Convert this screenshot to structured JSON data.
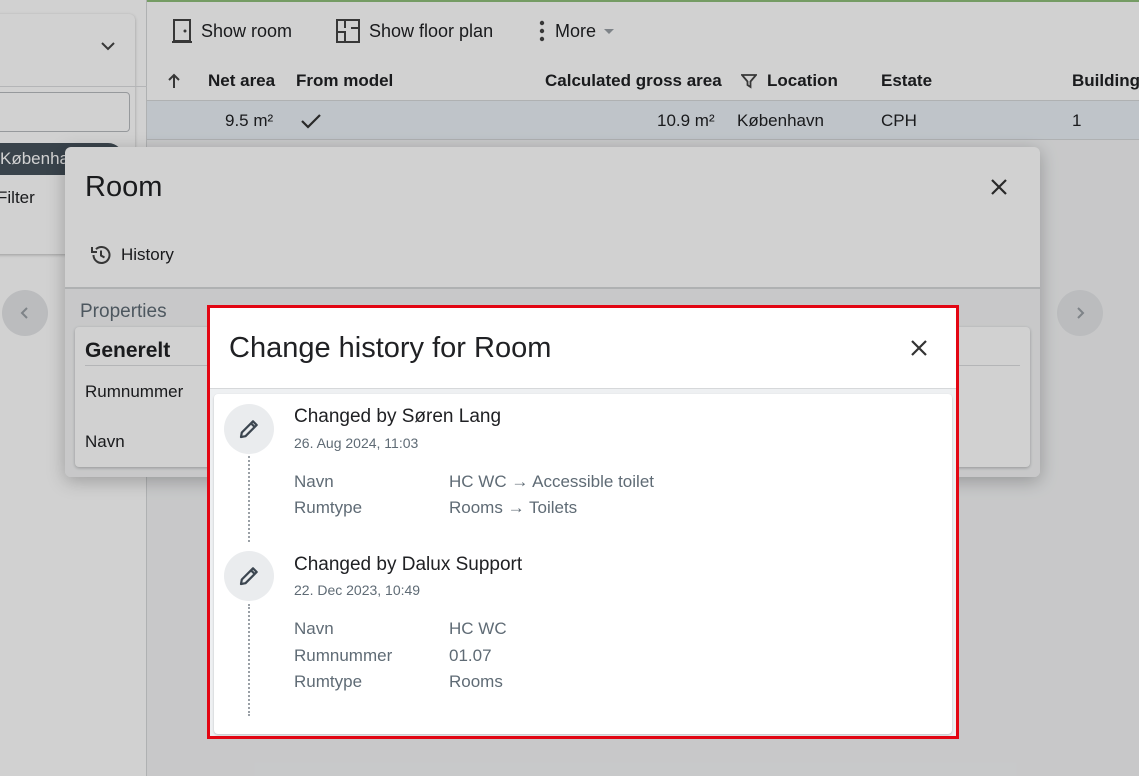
{
  "sidebar": {
    "chip_label": "København",
    "filter_label": "Filter"
  },
  "toolbar": {
    "show_room": "Show room",
    "show_floor_plan": "Show floor plan",
    "more": "More"
  },
  "table": {
    "columns": [
      "Net area",
      "From model",
      "Calculated gross area",
      "Location",
      "Estate",
      "Building"
    ],
    "row": {
      "net_area": "9.5 m²",
      "calculated_gross_area": "10.9 m²",
      "location": "København",
      "estate": "CPH",
      "building": "1"
    }
  },
  "room_dialog": {
    "title": "Room",
    "history_tab": "History",
    "properties_label": "Properties",
    "section_title": "Generelt",
    "fields": [
      "Rumnummer",
      "Navn"
    ]
  },
  "history_dialog": {
    "title": "Change history for Room",
    "entries": [
      {
        "author": "Changed by Søren Lang",
        "date": "26. Aug 2024, 11:03",
        "changes": [
          {
            "field": "Navn",
            "value": "HC WC → Accessible toilet"
          },
          {
            "field": "Rumtype",
            "value": "Rooms → Toilets"
          }
        ]
      },
      {
        "author": "Changed by Dalux Support",
        "date": "22. Dec 2023, 10:49",
        "changes": [
          {
            "field": "Navn",
            "value": "HC WC"
          },
          {
            "field": "Rumnummer",
            "value": "01.07"
          },
          {
            "field": "Rumtype",
            "value": "Rooms"
          }
        ]
      }
    ]
  },
  "colors": {
    "highlight_border": "#e30613",
    "chip_bg": "#46525c",
    "selected_row": "#eaf0f6"
  }
}
